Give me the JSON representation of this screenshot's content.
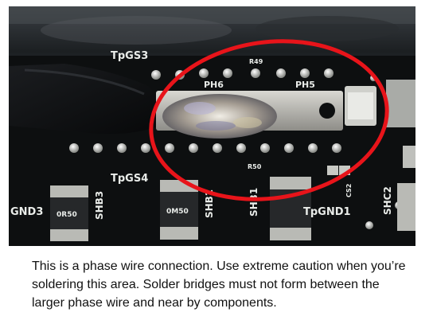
{
  "photo": {
    "silkscreen_labels": {
      "tpgs3": "TpGS3",
      "r49": "R49",
      "ph6": "PH6",
      "ph5": "PH5",
      "tpgs4": "TpGS4",
      "r50": "R50",
      "gnd3": "GND3",
      "shb3": "SHB3",
      "shb2": "SHB2",
      "shb1": "SHB1",
      "tpgnd1": "TpGND1",
      "shc2": "SHC2",
      "cs2": "CS2",
      "r005_a": "0R50",
      "r005_b": "0M50"
    },
    "highlight_color": "#e8141a",
    "board_color": "#0d0f10"
  },
  "caption": {
    "line1": "This is a phase wire connection. Use extreme caution when you’re",
    "line2": "soldering this area. Solder bridges must not form between the",
    "line3": "larger phase wire and near by components."
  }
}
